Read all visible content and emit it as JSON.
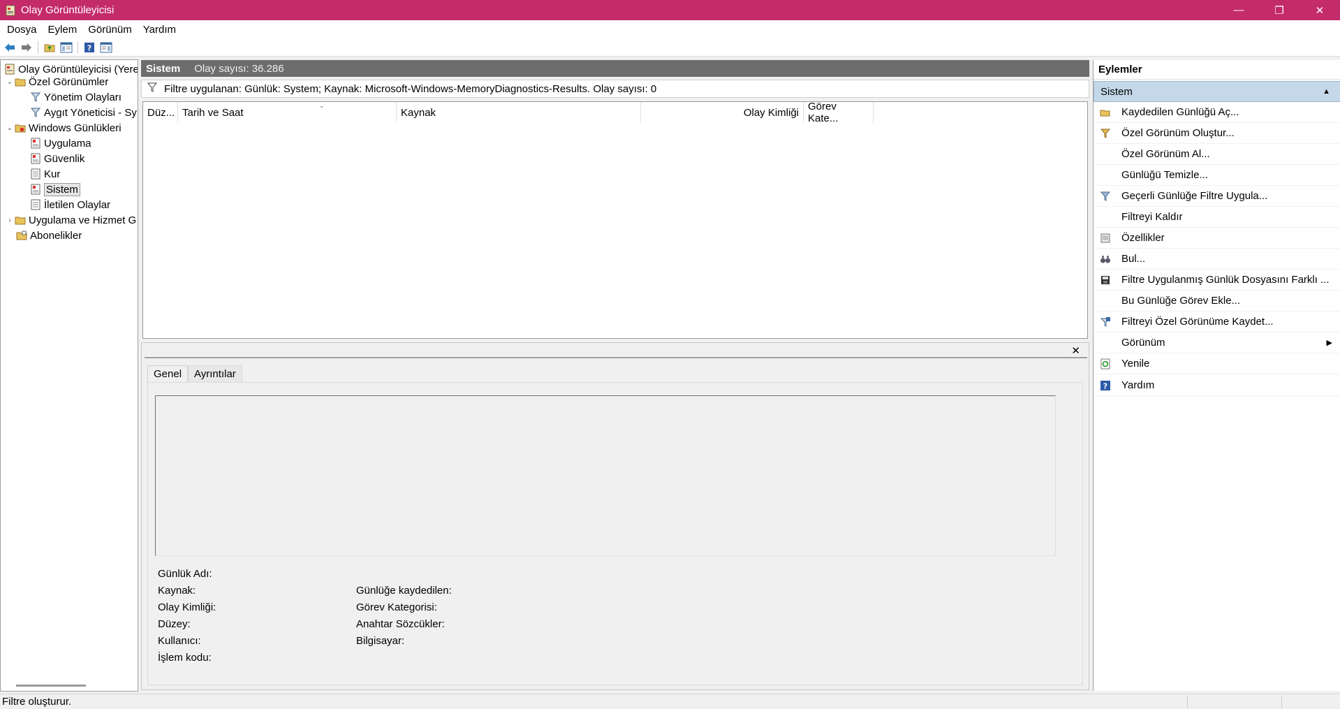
{
  "window": {
    "title": "Olay Görüntüleyicisi",
    "minimize": "—",
    "restore": "❐",
    "close": "✕"
  },
  "menu": [
    "Dosya",
    "Eylem",
    "Görünüm",
    "Yardım"
  ],
  "tree": {
    "root": "Olay Görüntüleyicisi (Yerel)",
    "custom_views": "Özel Görünümler",
    "admin_events": "Yönetim Olayları",
    "device_manager": "Aygıt Yöneticisi - Sy",
    "windows_logs": "Windows Günlükleri",
    "application": "Uygulama",
    "security": "Güvenlik",
    "setup": "Kur",
    "system": "Sistem",
    "forwarded": "İletilen Olaylar",
    "app_service": "Uygulama ve Hizmet G",
    "subscriptions": "Abonelikler"
  },
  "center": {
    "title": "Sistem",
    "count": "Olay sayısı: 36.286",
    "filter": "Filtre uygulanan: Günlük: System; Kaynak: Microsoft-Windows-MemoryDiagnostics-Results. Olay sayısı: 0",
    "columns": {
      "level": "Düz...",
      "datetime": "Tarih ve Saat",
      "source": "Kaynak",
      "event_id": "Olay Kimliği",
      "task": "Görev Kate..."
    }
  },
  "detail": {
    "close": "✕",
    "tabs": {
      "general": "Genel",
      "details": "Ayrıntılar"
    },
    "fields": {
      "log_name": "Günlük Adı:",
      "source": "Kaynak:",
      "event_id": "Olay Kimliği:",
      "level": "Düzey:",
      "user": "Kullanıcı:",
      "opcode": "İşlem kodu:",
      "logged": "Günlüğe kaydedilen:",
      "task_category": "Görev Kategorisi:",
      "keywords": "Anahtar Sözcükler:",
      "computer": "Bilgisayar:"
    }
  },
  "actions": {
    "title": "Eylemler",
    "section": "Sistem",
    "items": [
      "Kaydedilen Günlüğü Aç...",
      "Özel Görünüm Oluştur...",
      "Özel Görünüm Al...",
      "Günlüğü Temizle...",
      "Geçerli Günlüğe Filtre Uygula...",
      "Filtreyi Kaldır",
      "Özellikler",
      "Bul...",
      "Filtre Uygulanmış Günlük Dosyasını Farklı ...",
      "Bu Günlüğe Görev Ekle...",
      "Filtreyi Özel Görünüme Kaydet...",
      "Görünüm",
      "Yenile",
      "Yardım"
    ]
  },
  "status": {
    "text": "Filtre oluşturur."
  },
  "colors": {
    "titlebar": "#c42b6b",
    "section_header": "#c4d8ea",
    "center_header": "#6d6d6d"
  }
}
